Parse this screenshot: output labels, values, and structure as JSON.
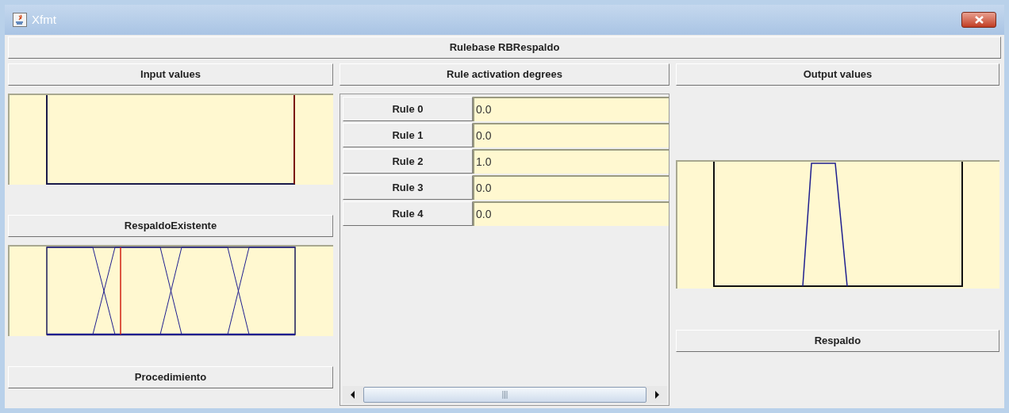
{
  "window": {
    "title": "Xfmt"
  },
  "rulebase": {
    "label": "Rulebase RBRespaldo"
  },
  "inputs": {
    "header": "Input values",
    "variables": [
      {
        "name": "RespaldoExistente"
      },
      {
        "name": "Procedimiento"
      }
    ]
  },
  "rules": {
    "header": "Rule activation degrees",
    "items": [
      {
        "label": "Rule 0",
        "value": "0.0"
      },
      {
        "label": "Rule 1",
        "value": "0.0"
      },
      {
        "label": "Rule 2",
        "value": "1.0"
      },
      {
        "label": "Rule 3",
        "value": "0.0"
      },
      {
        "label": "Rule 4",
        "value": "0.0"
      }
    ]
  },
  "outputs": {
    "header": "Output values",
    "variables": [
      {
        "name": "Respaldo"
      }
    ]
  }
}
